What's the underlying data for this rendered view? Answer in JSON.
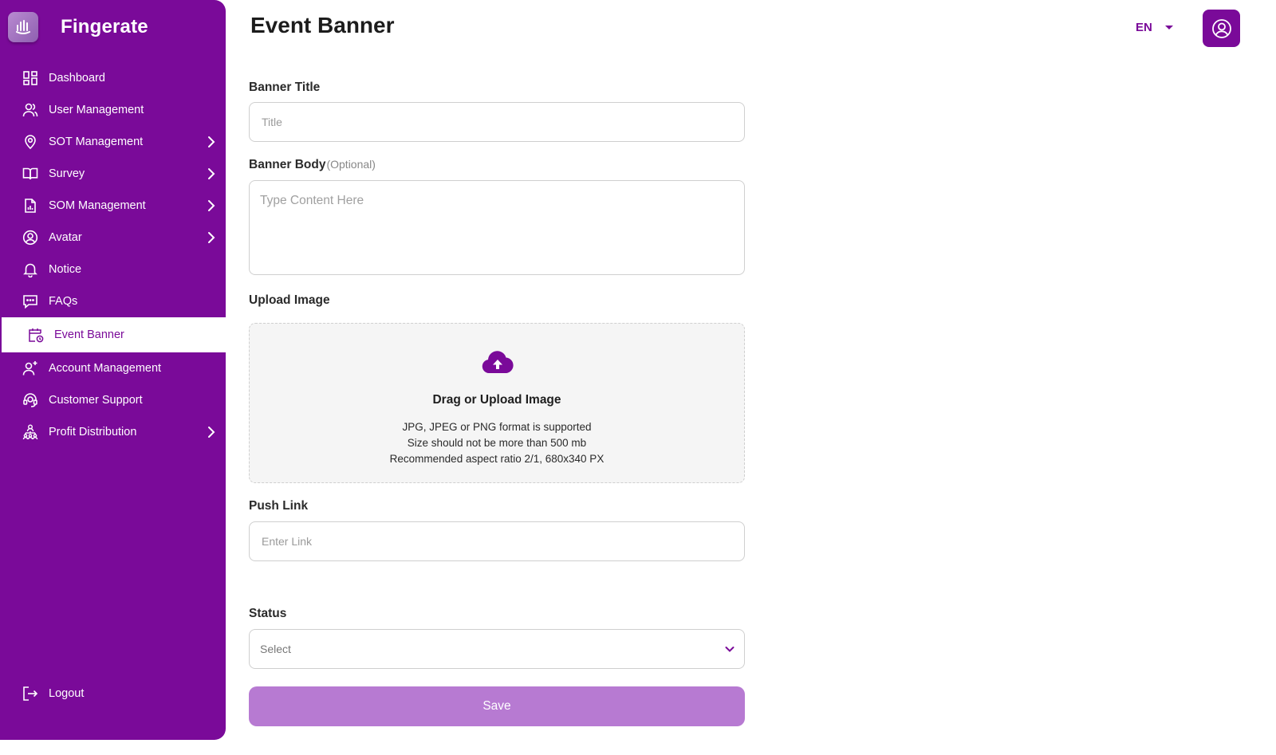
{
  "brand": {
    "name": "Fingerate"
  },
  "sidebar": {
    "items": [
      {
        "label": "Dashboard",
        "icon": "dashboard-icon"
      },
      {
        "label": "User Management",
        "icon": "users-icon"
      },
      {
        "label": "SOT Management",
        "icon": "location-pin-icon",
        "has_submenu": true
      },
      {
        "label": "Survey",
        "icon": "book-open-icon",
        "has_submenu": true
      },
      {
        "label": "SOM Management",
        "icon": "document-chart-icon",
        "has_submenu": true
      },
      {
        "label": "Avatar",
        "icon": "user-circle-icon",
        "has_submenu": true
      },
      {
        "label": "Notice",
        "icon": "bell-icon"
      },
      {
        "label": "FAQs",
        "icon": "chat-bubble-icon"
      },
      {
        "label": "Event Banner",
        "icon": "calendar-clock-icon",
        "active": true
      },
      {
        "label": "Account Management",
        "icon": "user-plus-icon"
      },
      {
        "label": "Customer Support",
        "icon": "headset-icon"
      },
      {
        "label": "Profit Distribution",
        "icon": "hierarchy-icon",
        "has_submenu": true
      }
    ],
    "logout": {
      "label": "Logout",
      "icon": "logout-icon"
    }
  },
  "header": {
    "title": "Event Banner",
    "language": "EN"
  },
  "form": {
    "banner_title": {
      "label": "Banner Title",
      "placeholder": "Title",
      "value": ""
    },
    "banner_body": {
      "label": "Banner Body",
      "optional": "(Optional)",
      "placeholder": "Type Content Here",
      "value": ""
    },
    "upload_image": {
      "label": "Upload Image",
      "title": "Drag or Upload Image",
      "line1": "JPG, JPEG or PNG format is supported",
      "line2": "Size should not be more than 500 mb",
      "line3": "Recommended aspect ratio 2/1, 680x340 PX"
    },
    "push_link": {
      "label": "Push Link",
      "placeholder": "Enter Link",
      "value": ""
    },
    "status": {
      "label": "Status",
      "selected": "Select"
    },
    "save_label": "Save"
  },
  "colors": {
    "brand_purple": "#7a0a99",
    "save_button": "#b77ad2",
    "upload_bg": "#f5f5f5"
  }
}
